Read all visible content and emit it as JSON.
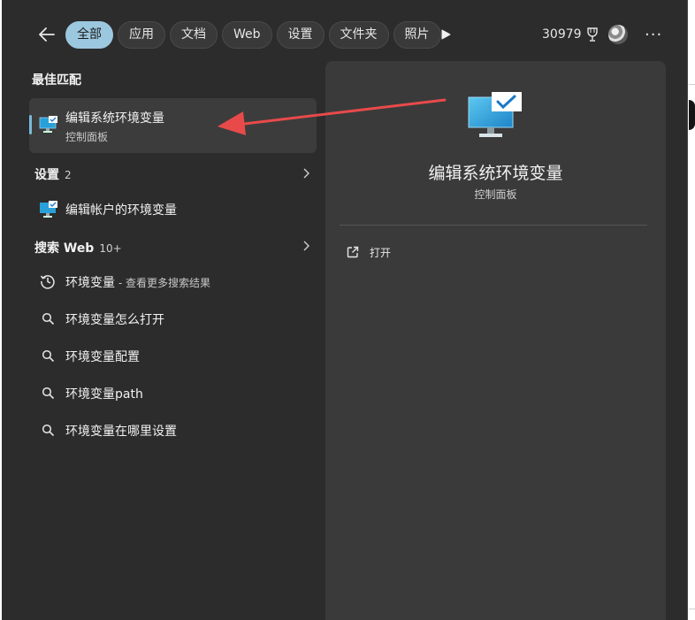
{
  "header": {
    "tabs": [
      {
        "label": "全部",
        "active": true
      },
      {
        "label": "应用"
      },
      {
        "label": "文档"
      },
      {
        "label": "Web"
      },
      {
        "label": "设置"
      },
      {
        "label": "文件夹"
      },
      {
        "label": "照片"
      }
    ],
    "points": "30979"
  },
  "best_match": {
    "heading": "最佳匹配",
    "title": "编辑系统环境变量",
    "subtitle": "控制面板"
  },
  "settings": {
    "heading": "设置",
    "count": "2",
    "items": [
      {
        "label": "编辑帐户的环境变量"
      }
    ]
  },
  "web": {
    "heading": "搜索 Web",
    "count": "10+",
    "items": [
      {
        "label": "环境变量",
        "suffix": " - 查看更多搜索结果",
        "icon": "history-icon"
      },
      {
        "label": "环境变量怎么打开",
        "icon": "search-icon"
      },
      {
        "label": "环境变量配置",
        "icon": "search-icon"
      },
      {
        "label": "环境变量path",
        "icon": "search-icon"
      },
      {
        "label": "环境变量在哪里设置",
        "icon": "search-icon"
      }
    ]
  },
  "preview": {
    "title": "编辑系统环境变量",
    "subtitle": "控制面板",
    "open_label": "打开"
  },
  "colors": {
    "panel_bg": "#2c2c2c",
    "preview_bg": "#3a3a3a",
    "active_tab": "#9cc8df",
    "accent": "#79b9d9",
    "annotation_arrow": "#e84a4a"
  }
}
